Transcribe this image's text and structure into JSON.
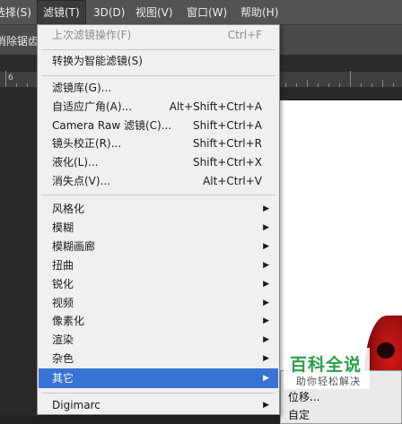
{
  "menubar": {
    "items": [
      {
        "label": "选择(S)"
      },
      {
        "label": "滤镜(T)"
      },
      {
        "label": "3D(D)"
      },
      {
        "label": "视图(V)"
      },
      {
        "label": "窗口(W)"
      },
      {
        "label": "帮助(H)"
      }
    ]
  },
  "options_bar": {
    "label": "消除锯齿"
  },
  "ruler": {
    "labels": [
      "6"
    ]
  },
  "filter_menu": {
    "last_filter": {
      "label": "上次滤镜操作(F)",
      "shortcut": "Ctrl+F"
    },
    "convert_smart": {
      "label": "转换为智能滤镜(S)"
    },
    "filter_gallery": {
      "label": "滤镜库(G)..."
    },
    "adaptive_wide": {
      "label": "自适应广角(A)...",
      "shortcut": "Alt+Shift+Ctrl+A"
    },
    "camera_raw": {
      "label": "Camera Raw 滤镜(C)...",
      "shortcut": "Shift+Ctrl+A"
    },
    "lens_correction": {
      "label": "镜头校正(R)...",
      "shortcut": "Shift+Ctrl+R"
    },
    "liquify": {
      "label": "液化(L)...",
      "shortcut": "Shift+Ctrl+X"
    },
    "vanishing_point": {
      "label": "消失点(V)...",
      "shortcut": "Alt+Ctrl+V"
    },
    "submenus": [
      {
        "label": "风格化"
      },
      {
        "label": "模糊"
      },
      {
        "label": "模糊画廊"
      },
      {
        "label": "扭曲"
      },
      {
        "label": "锐化"
      },
      {
        "label": "视频"
      },
      {
        "label": "像素化"
      },
      {
        "label": "渲染"
      },
      {
        "label": "杂色"
      },
      {
        "label": "其它"
      }
    ],
    "digimarc": {
      "label": "Digimarc"
    },
    "arrow_glyph": "▶"
  },
  "other_submenu": {
    "items": [
      {
        "label": "位移..."
      },
      {
        "label": "自定"
      }
    ]
  },
  "watermark": {
    "title": "百科全说",
    "subtitle": "助你轻松解决"
  },
  "colors": {
    "highlight": "#3874d4",
    "menu_bg": "#f0f0f0",
    "watermark_green": "#2aa04a"
  }
}
